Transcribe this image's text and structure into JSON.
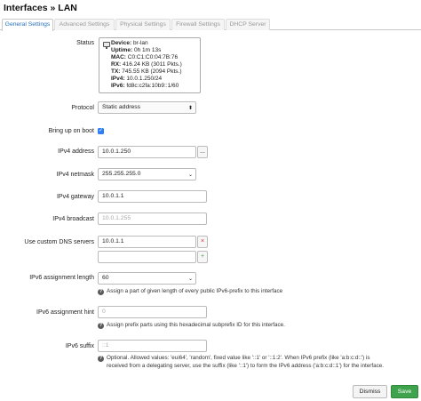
{
  "page": {
    "title": "Interfaces » LAN"
  },
  "tabs": [
    {
      "label": "General Settings"
    },
    {
      "label": "Advanced Settings"
    },
    {
      "label": "Physical Settings"
    },
    {
      "label": "Firewall Settings"
    },
    {
      "label": "DHCP Server"
    }
  ],
  "status": {
    "label": "Status",
    "rows": [
      {
        "k": "Device:",
        "v": "br-lan"
      },
      {
        "k": "Uptime:",
        "v": "0h 1m 13s"
      },
      {
        "k": "MAC:",
        "v": "C0:C1:C0:04:7B:76"
      },
      {
        "k": "RX:",
        "v": "416.24 KB (3011 Pkts.)"
      },
      {
        "k": "TX:",
        "v": "745.55 KB (2094 Pkts.)"
      },
      {
        "k": "IPv4:",
        "v": "10.0.1.250/24"
      },
      {
        "k": "IPv6:",
        "v": "fd8c:c2fa:10b9::1/60"
      }
    ]
  },
  "protocol": {
    "label": "Protocol",
    "value": "Static address"
  },
  "bring_up": {
    "label": "Bring up on boot",
    "checked": true
  },
  "ipv4_address": {
    "label": "IPv4 address",
    "value": "10.0.1.250",
    "button": "..."
  },
  "ipv4_netmask": {
    "label": "IPv4 netmask",
    "value": "255.255.255.0"
  },
  "ipv4_gateway": {
    "label": "IPv4 gateway",
    "value": "10.0.1.1"
  },
  "ipv4_broadcast": {
    "label": "IPv4 broadcast",
    "placeholder": "10.0.1.255"
  },
  "dns": {
    "label": "Use custom DNS servers",
    "value": "10.0.1.1",
    "remove": "×",
    "add": "+"
  },
  "ipv6_assign_len": {
    "label": "IPv6 assignment length",
    "value": "60",
    "hint": "Assign a part of given length of every public IPv6-prefix to this interface"
  },
  "ipv6_assign_hint": {
    "label": "IPv6 assignment hint",
    "placeholder": "0",
    "hint": "Assign prefix parts using this hexadecimal subprefix ID for this interface."
  },
  "ipv6_suffix": {
    "label": "IPv6 suffix",
    "placeholder": "::1",
    "hint_line1": "Optional. Allowed values: 'eui64', 'random', fixed value like '::1' or '::1:2'. When IPv6 prefix (like 'a:b:c:d::')  is",
    "hint_line2": "received from a delegating server, use the suffix (like '::1') to form the IPv6 address ('a:b:c:d::1') for the interface."
  },
  "footer": {
    "dismiss": "Dismiss",
    "save": "Save"
  },
  "colors": {
    "accent": "#2a6fb8",
    "save": "#3fa34d",
    "checkbox": "#2d7ff9"
  }
}
